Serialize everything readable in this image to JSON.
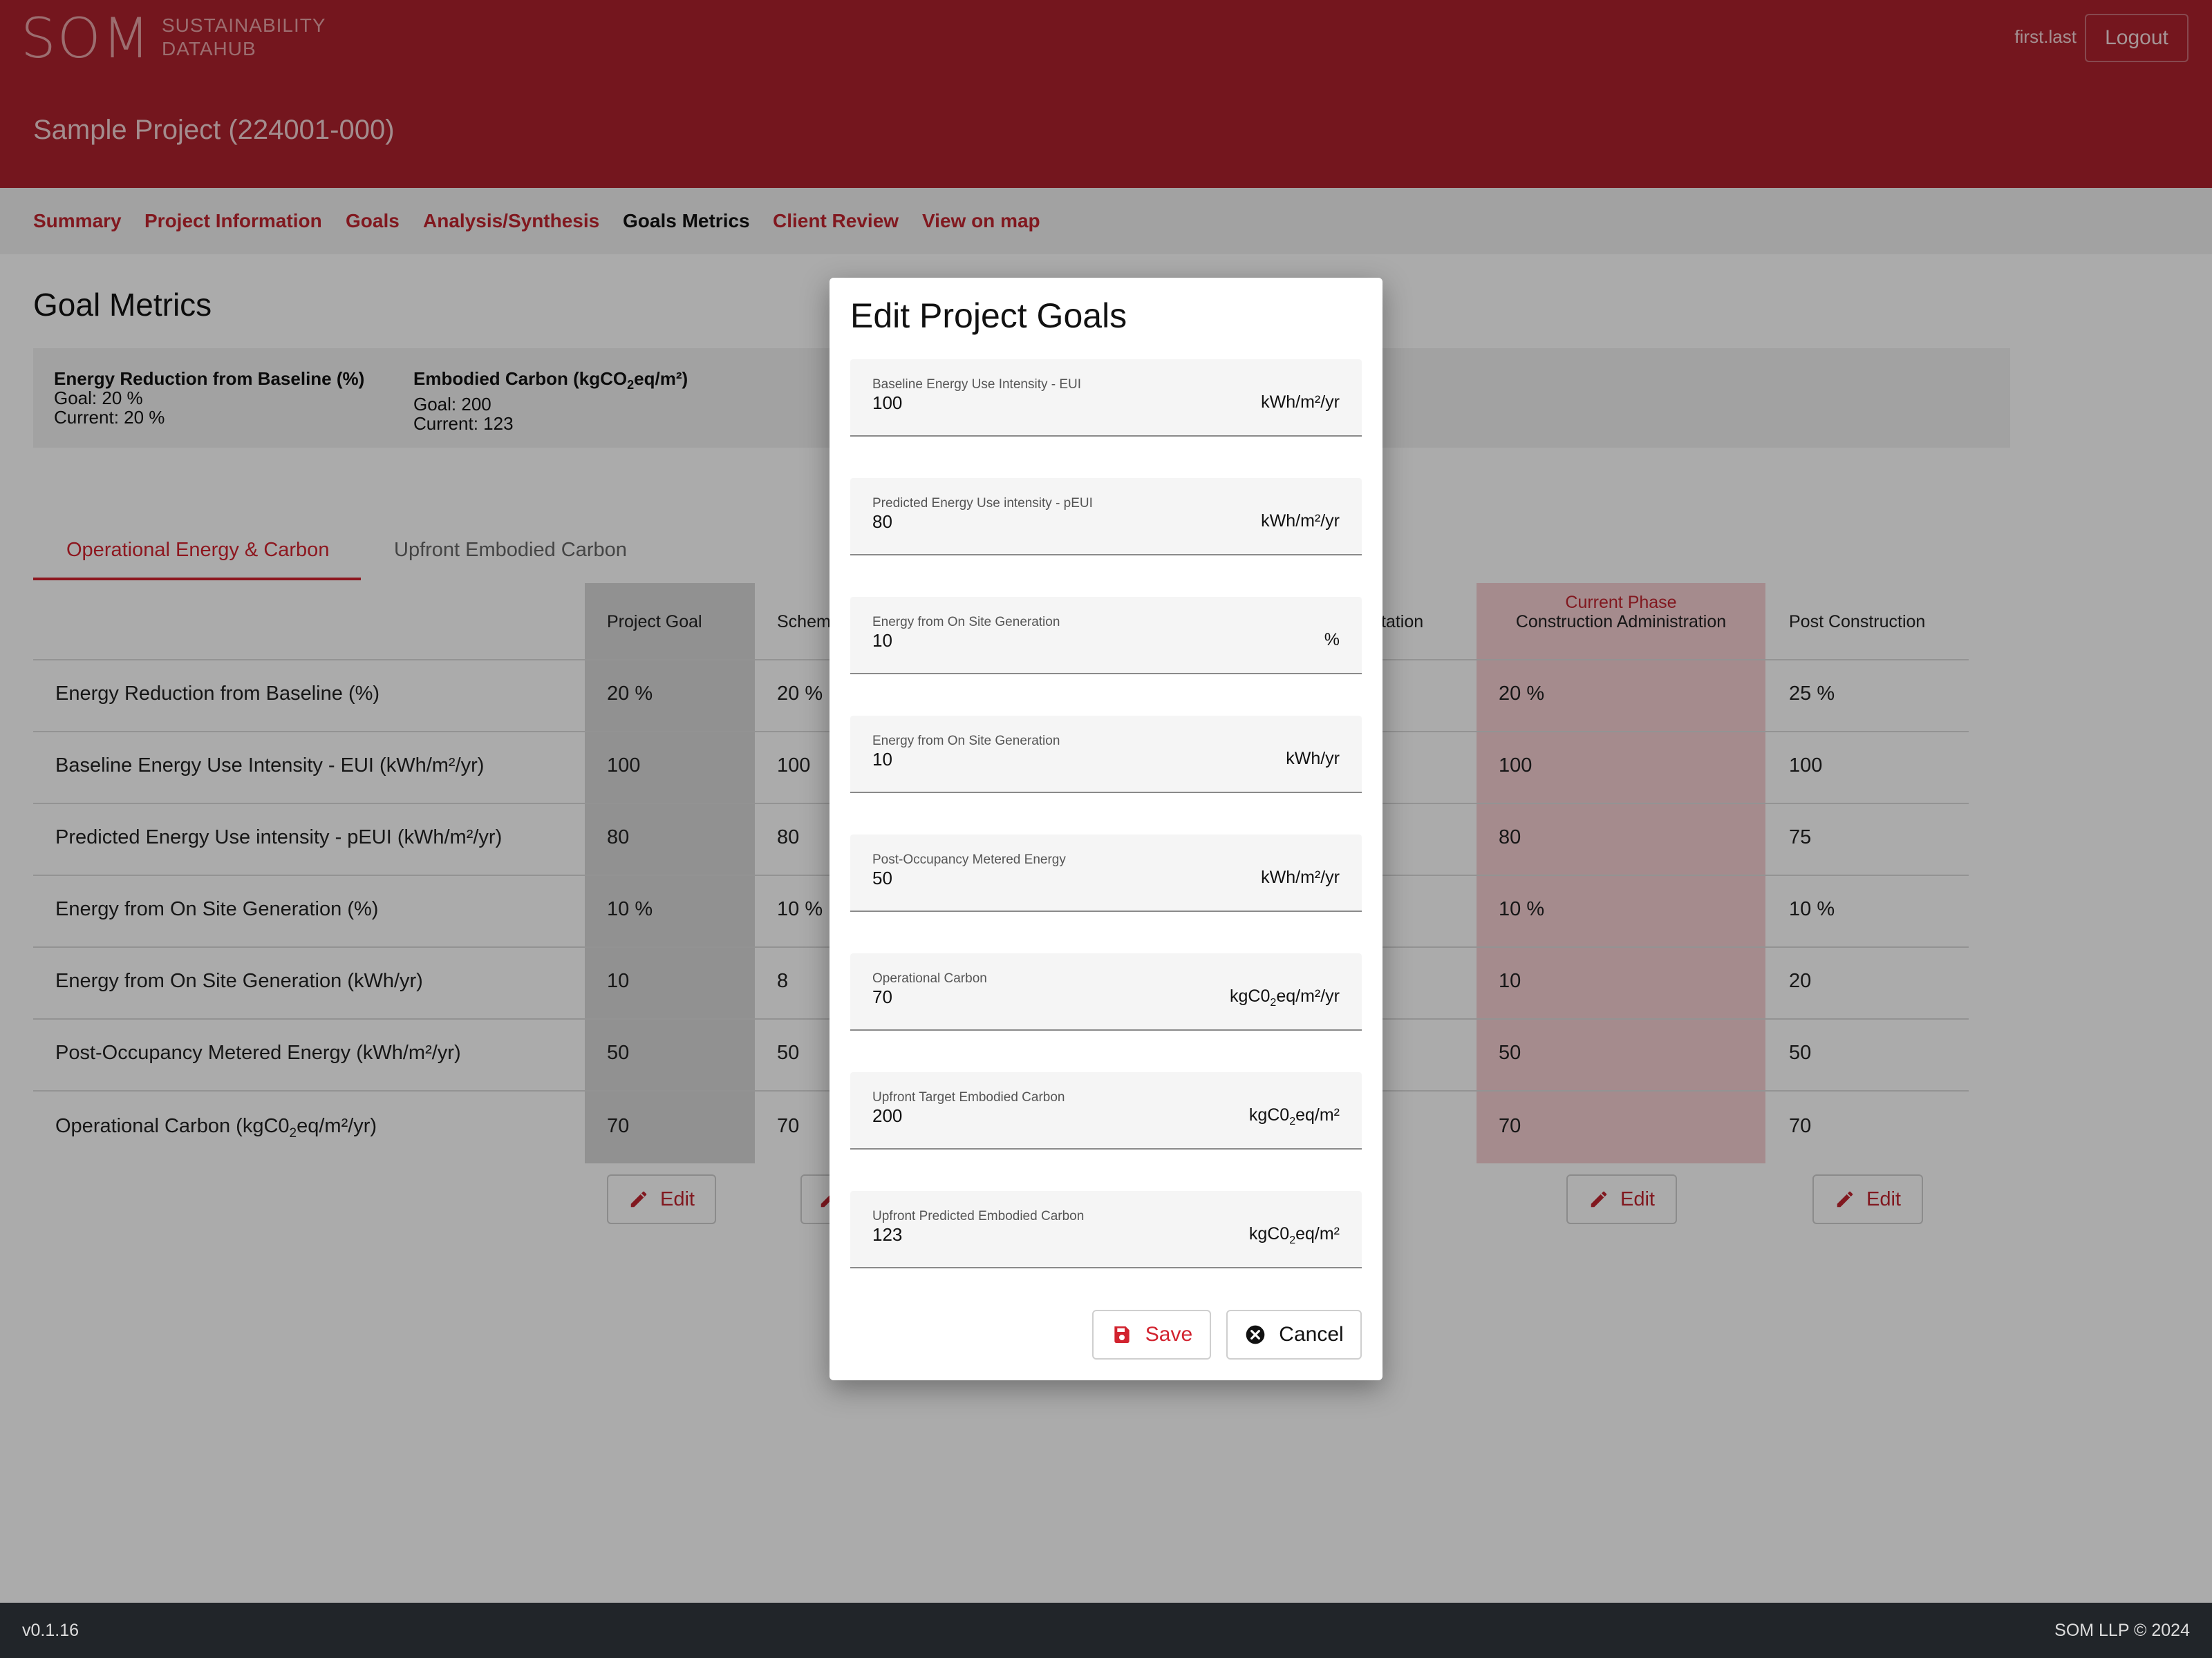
{
  "header": {
    "logo": "SOM",
    "logo_sub_line1": "SUSTAINABILITY",
    "logo_sub_line2": "DATAHUB",
    "user": "first.last",
    "logout_label": "Logout",
    "brand_color": "#ad212d"
  },
  "project": {
    "title": "Sample Project (224001-000)"
  },
  "nav": {
    "items": [
      {
        "label": "Summary"
      },
      {
        "label": "Project Information"
      },
      {
        "label": "Goals"
      },
      {
        "label": "Analysis/Synthesis"
      },
      {
        "label": "Goals Metrics",
        "active": true
      },
      {
        "label": "Client Review"
      },
      {
        "label": "View on map"
      }
    ]
  },
  "page": {
    "title": "Goal Metrics",
    "summary": [
      {
        "heading": "Energy Reduction from Baseline (%)",
        "goal": "Goal: 20 %",
        "current": "Current: 20 %"
      },
      {
        "heading_pre": "Embodied Carbon (kgCO",
        "heading_sub": "2",
        "heading_post": "eq/m²)",
        "goal": "Goal: 200",
        "current": "Current: 123"
      }
    ],
    "tabs": [
      {
        "label": "Operational Energy & Carbon",
        "active": true
      },
      {
        "label": "Upfront Embodied Carbon"
      }
    ]
  },
  "table": {
    "columns": [
      {
        "label": "Project Goal"
      },
      {
        "label": "Schem"
      },
      {
        "label": "tation"
      },
      {
        "label": "Construction Administration",
        "phase": "Current Phase"
      },
      {
        "label": "Post Construction"
      }
    ],
    "rows": [
      {
        "label": "Energy Reduction from Baseline (%)",
        "values": [
          "20 %",
          "20 %",
          "20 %",
          "25 %"
        ]
      },
      {
        "label": "Baseline Energy Use Intensity - EUI (kWh/m²/yr)",
        "values": [
          "100",
          "100",
          "100",
          "100"
        ]
      },
      {
        "label": "Predicted Energy Use intensity - pEUI (kWh/m²/yr)",
        "values": [
          "80",
          "80",
          "80",
          "75"
        ]
      },
      {
        "label": "Energy from On Site Generation (%)",
        "values": [
          "10 %",
          "10 %",
          "10 %",
          "10 %"
        ]
      },
      {
        "label": "Energy from On Site Generation (kWh/yr)",
        "values": [
          "10",
          "8",
          "10",
          "20"
        ]
      },
      {
        "label": "Post-Occupancy Metered Energy (kWh/m²/yr)",
        "values": [
          "50",
          "50",
          "50",
          "50"
        ]
      },
      {
        "label_pre": "Operational Carbon (kgC0",
        "label_sub": "2",
        "label_post": "eq/m²/yr)",
        "values": [
          "70",
          "70",
          "70",
          "70"
        ]
      }
    ],
    "edit_label": "Edit"
  },
  "modal": {
    "title": "Edit Project Goals",
    "fields": [
      {
        "label": "Baseline Energy Use Intensity - EUI",
        "value": "100",
        "unit": "kWh/m²/yr"
      },
      {
        "label": "Predicted Energy Use intensity - pEUI",
        "value": "80",
        "unit": "kWh/m²/yr"
      },
      {
        "label": "Energy from On Site Generation",
        "value": "10",
        "unit": "%"
      },
      {
        "label": "Energy from On Site Generation",
        "value": "10",
        "unit": "kWh/yr"
      },
      {
        "label": "Post-Occupancy Metered Energy",
        "value": "50",
        "unit": "kWh/m²/yr"
      },
      {
        "label": "Operational Carbon",
        "value": "70",
        "unit_pre": "kgC0",
        "unit_sub": "2",
        "unit_post": "eq/m²/yr"
      },
      {
        "label": "Upfront Target Embodied Carbon",
        "value": "200",
        "unit_pre": "kgC0",
        "unit_sub": "2",
        "unit_post": "eq/m²"
      },
      {
        "label": "Upfront Predicted Embodied Carbon",
        "value": "123",
        "unit_pre": "kgC0",
        "unit_sub": "2",
        "unit_post": "eq/m²"
      }
    ],
    "save_label": "Save",
    "cancel_label": "Cancel"
  },
  "footer": {
    "version": "v0.1.16",
    "copyright": "SOM LLP © 2024"
  }
}
